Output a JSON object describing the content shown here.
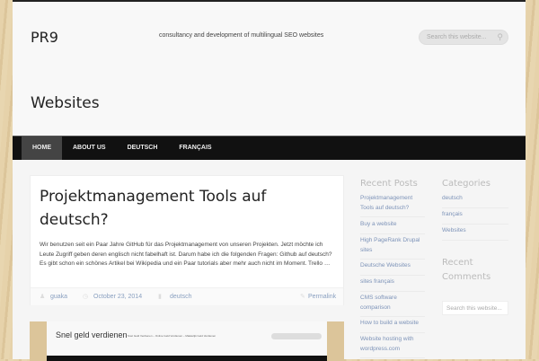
{
  "header": {
    "site_title": "PR9",
    "tagline": "consultancy and development of multilingual SEO websites",
    "search_placeholder": "Search this website..."
  },
  "page_title": "Websites",
  "nav": [
    "HOME",
    "ABOUT US",
    "DEUTSCH",
    "FRANÇAIS"
  ],
  "post": {
    "title": "Projektmanagement Tools auf deutsch?",
    "excerpt": "Wir benutzen seit ein Paar Jahre GitHub für das Projektmanagement von unseren Projekten. Jetzt möchte ich Leute Zugriff geben deren englisch nicht fabelhaft ist. Darum habe ich die folgenden Fragen: Github auf deutsch? Es gibt schon ein schönes Artikel bei Wikipedia und ein Paar tutorials aber mehr auch nicht im Moment. Trello …",
    "author": "guaka",
    "date": "October 23, 2014",
    "category": "deutsch",
    "permalink": "Permalink"
  },
  "thumb": {
    "title": "Snel geld verdienen",
    "subtitle": "Snel Geld Verdienen – Online Geld Verdienen – Makkelijk Geld Verdienen"
  },
  "sidebar": {
    "recent_posts_title": "Recent Posts",
    "recent_posts": [
      "Projektmanagement Tools auf deutsch?",
      "Buy a website",
      "High PageRank Drupal sites",
      "Deutsche Websites",
      "sites français",
      "CMS software comparison",
      "How to build a website",
      "Website hosting with wordpress.com"
    ],
    "categories_title": "Categories",
    "categories": [
      "deutsch",
      "français",
      "Websites"
    ],
    "recent_comments_title": "Recent Comments",
    "search_placeholder": "Search this website..."
  }
}
